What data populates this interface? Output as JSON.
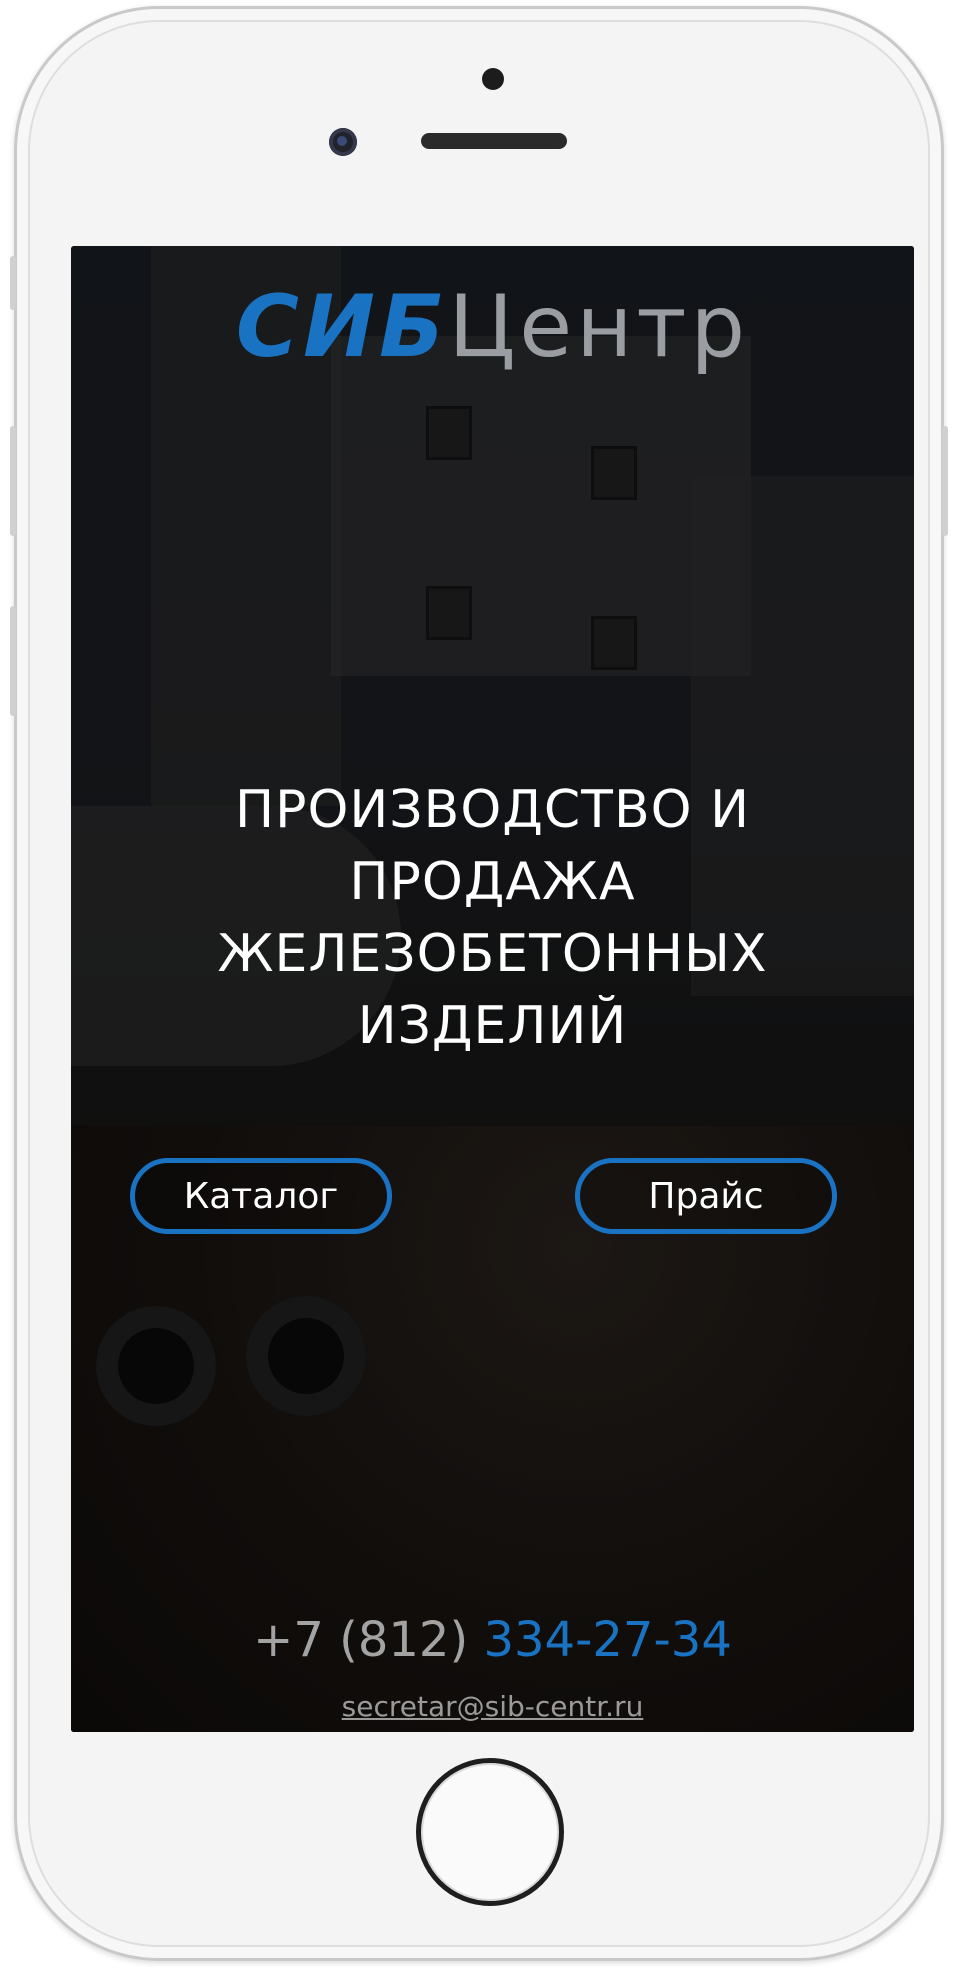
{
  "logo": {
    "part1": "СИБ",
    "part2": "Центр"
  },
  "hero": {
    "headline": "ПРОИЗВОДСТВО И ПРОДАЖА ЖЕЛЕЗОБЕТОННЫХ ИЗДЕЛИЙ"
  },
  "buttons": {
    "catalog": "Каталог",
    "price": "Прайс"
  },
  "contacts": {
    "phone_prefix": "+7 (812) ",
    "phone_number": "334-27-34",
    "email": "secretar@sib-centr.ru"
  },
  "colors": {
    "accent": "#1a73c2",
    "muted_text": "#a3a3a3",
    "headline": "#ffffff"
  },
  "icons": {
    "home": "home-button-icon",
    "camera": "front-camera-icon",
    "speaker": "earpiece-speaker-icon"
  }
}
